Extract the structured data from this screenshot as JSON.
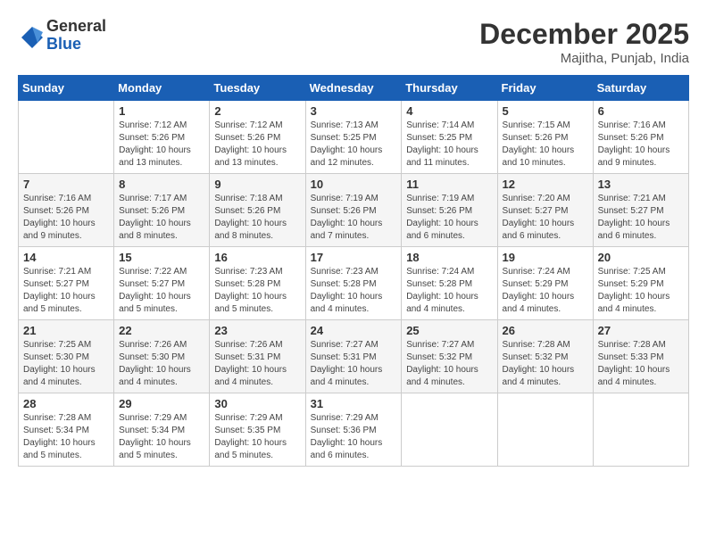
{
  "header": {
    "logo": {
      "general": "General",
      "blue": "Blue"
    },
    "title": "December 2025",
    "location": "Majitha, Punjab, India"
  },
  "calendar": {
    "weekdays": [
      "Sunday",
      "Monday",
      "Tuesday",
      "Wednesday",
      "Thursday",
      "Friday",
      "Saturday"
    ],
    "weeks": [
      [
        {
          "day": "",
          "info": ""
        },
        {
          "day": "1",
          "info": "Sunrise: 7:12 AM\nSunset: 5:26 PM\nDaylight: 10 hours\nand 13 minutes."
        },
        {
          "day": "2",
          "info": "Sunrise: 7:12 AM\nSunset: 5:26 PM\nDaylight: 10 hours\nand 13 minutes."
        },
        {
          "day": "3",
          "info": "Sunrise: 7:13 AM\nSunset: 5:25 PM\nDaylight: 10 hours\nand 12 minutes."
        },
        {
          "day": "4",
          "info": "Sunrise: 7:14 AM\nSunset: 5:25 PM\nDaylight: 10 hours\nand 11 minutes."
        },
        {
          "day": "5",
          "info": "Sunrise: 7:15 AM\nSunset: 5:26 PM\nDaylight: 10 hours\nand 10 minutes."
        },
        {
          "day": "6",
          "info": "Sunrise: 7:16 AM\nSunset: 5:26 PM\nDaylight: 10 hours\nand 9 minutes."
        }
      ],
      [
        {
          "day": "7",
          "info": "Sunrise: 7:16 AM\nSunset: 5:26 PM\nDaylight: 10 hours\nand 9 minutes."
        },
        {
          "day": "8",
          "info": "Sunrise: 7:17 AM\nSunset: 5:26 PM\nDaylight: 10 hours\nand 8 minutes."
        },
        {
          "day": "9",
          "info": "Sunrise: 7:18 AM\nSunset: 5:26 PM\nDaylight: 10 hours\nand 8 minutes."
        },
        {
          "day": "10",
          "info": "Sunrise: 7:19 AM\nSunset: 5:26 PM\nDaylight: 10 hours\nand 7 minutes."
        },
        {
          "day": "11",
          "info": "Sunrise: 7:19 AM\nSunset: 5:26 PM\nDaylight: 10 hours\nand 6 minutes."
        },
        {
          "day": "12",
          "info": "Sunrise: 7:20 AM\nSunset: 5:27 PM\nDaylight: 10 hours\nand 6 minutes."
        },
        {
          "day": "13",
          "info": "Sunrise: 7:21 AM\nSunset: 5:27 PM\nDaylight: 10 hours\nand 6 minutes."
        }
      ],
      [
        {
          "day": "14",
          "info": "Sunrise: 7:21 AM\nSunset: 5:27 PM\nDaylight: 10 hours\nand 5 minutes."
        },
        {
          "day": "15",
          "info": "Sunrise: 7:22 AM\nSunset: 5:27 PM\nDaylight: 10 hours\nand 5 minutes."
        },
        {
          "day": "16",
          "info": "Sunrise: 7:23 AM\nSunset: 5:28 PM\nDaylight: 10 hours\nand 5 minutes."
        },
        {
          "day": "17",
          "info": "Sunrise: 7:23 AM\nSunset: 5:28 PM\nDaylight: 10 hours\nand 4 minutes."
        },
        {
          "day": "18",
          "info": "Sunrise: 7:24 AM\nSunset: 5:28 PM\nDaylight: 10 hours\nand 4 minutes."
        },
        {
          "day": "19",
          "info": "Sunrise: 7:24 AM\nSunset: 5:29 PM\nDaylight: 10 hours\nand 4 minutes."
        },
        {
          "day": "20",
          "info": "Sunrise: 7:25 AM\nSunset: 5:29 PM\nDaylight: 10 hours\nand 4 minutes."
        }
      ],
      [
        {
          "day": "21",
          "info": "Sunrise: 7:25 AM\nSunset: 5:30 PM\nDaylight: 10 hours\nand 4 minutes."
        },
        {
          "day": "22",
          "info": "Sunrise: 7:26 AM\nSunset: 5:30 PM\nDaylight: 10 hours\nand 4 minutes."
        },
        {
          "day": "23",
          "info": "Sunrise: 7:26 AM\nSunset: 5:31 PM\nDaylight: 10 hours\nand 4 minutes."
        },
        {
          "day": "24",
          "info": "Sunrise: 7:27 AM\nSunset: 5:31 PM\nDaylight: 10 hours\nand 4 minutes."
        },
        {
          "day": "25",
          "info": "Sunrise: 7:27 AM\nSunset: 5:32 PM\nDaylight: 10 hours\nand 4 minutes."
        },
        {
          "day": "26",
          "info": "Sunrise: 7:28 AM\nSunset: 5:32 PM\nDaylight: 10 hours\nand 4 minutes."
        },
        {
          "day": "27",
          "info": "Sunrise: 7:28 AM\nSunset: 5:33 PM\nDaylight: 10 hours\nand 4 minutes."
        }
      ],
      [
        {
          "day": "28",
          "info": "Sunrise: 7:28 AM\nSunset: 5:34 PM\nDaylight: 10 hours\nand 5 minutes."
        },
        {
          "day": "29",
          "info": "Sunrise: 7:29 AM\nSunset: 5:34 PM\nDaylight: 10 hours\nand 5 minutes."
        },
        {
          "day": "30",
          "info": "Sunrise: 7:29 AM\nSunset: 5:35 PM\nDaylight: 10 hours\nand 5 minutes."
        },
        {
          "day": "31",
          "info": "Sunrise: 7:29 AM\nSunset: 5:36 PM\nDaylight: 10 hours\nand 6 minutes."
        },
        {
          "day": "",
          "info": ""
        },
        {
          "day": "",
          "info": ""
        },
        {
          "day": "",
          "info": ""
        }
      ]
    ]
  }
}
